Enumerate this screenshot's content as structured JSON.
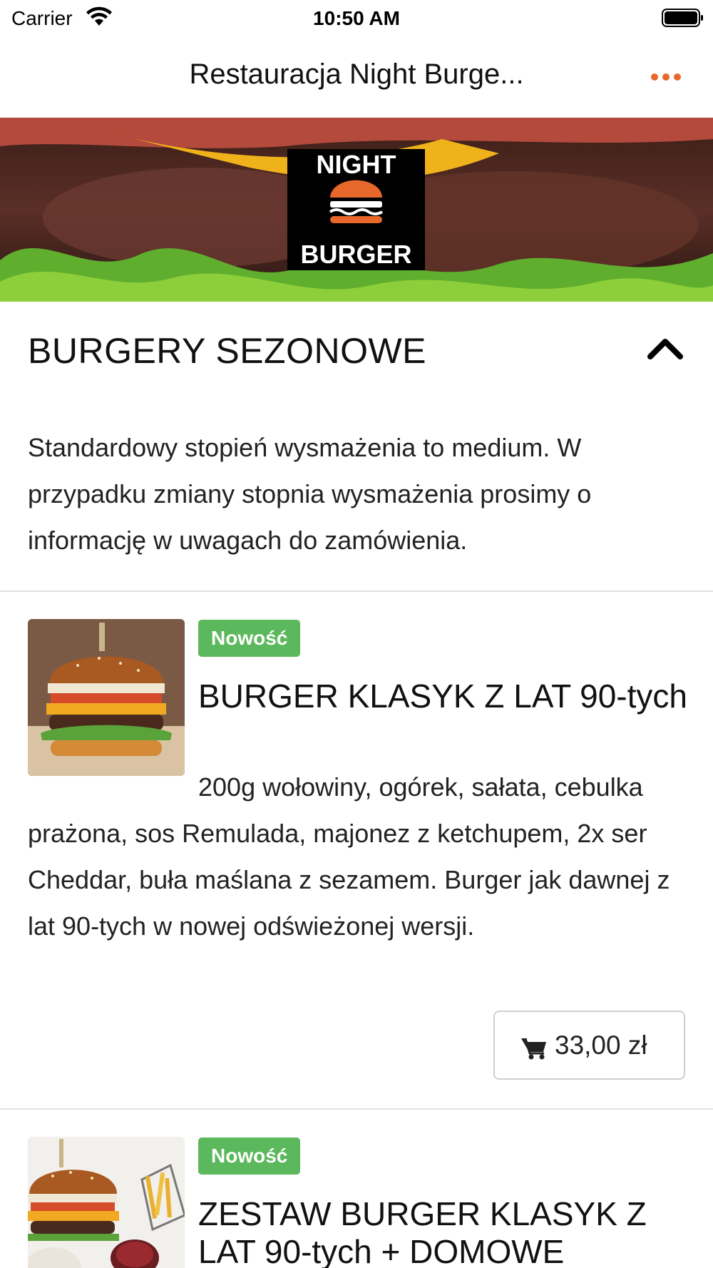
{
  "status_bar": {
    "carrier": "Carrier",
    "time": "10:50 AM",
    "wifi_icon": "wifi-icon",
    "battery_icon": "battery-full-icon"
  },
  "nav": {
    "title": "Restauracja Night Burge...",
    "more_icon": "more-horizontal-icon",
    "accent_color": "#e8672a"
  },
  "hero": {
    "logo_line1": "NIGHT",
    "logo_line2": "BURGER"
  },
  "section": {
    "title": "BURGERY SEZONOWE",
    "toggle_icon": "chevron-up-icon",
    "description": "Standardowy stopień wysmażenia to medium. W przypadku zmiany stopnia wysmażenia prosimy o informację w uwagach do zamówienia."
  },
  "items": [
    {
      "badge": "Nowość",
      "title": "BURGER KLASYK Z LAT 90-tych",
      "description": "200g wołowiny, ogórek, sałata, cebulka prażona, sos Remulada, majonez z ketchupem, 2x ser Cheddar, buła maślana z sezamem. Burger jak dawnej z lat 90-tych w nowej odświeżonej wersji.",
      "price": "33,00 zł",
      "cart_icon": "cart-icon"
    },
    {
      "badge": "Nowość",
      "title": "ZESTAW BURGER KLASYK Z LAT 90-tych + DOMOWE"
    }
  ],
  "colors": {
    "badge_green": "#5cb85c",
    "divider": "#e3e3e3"
  }
}
